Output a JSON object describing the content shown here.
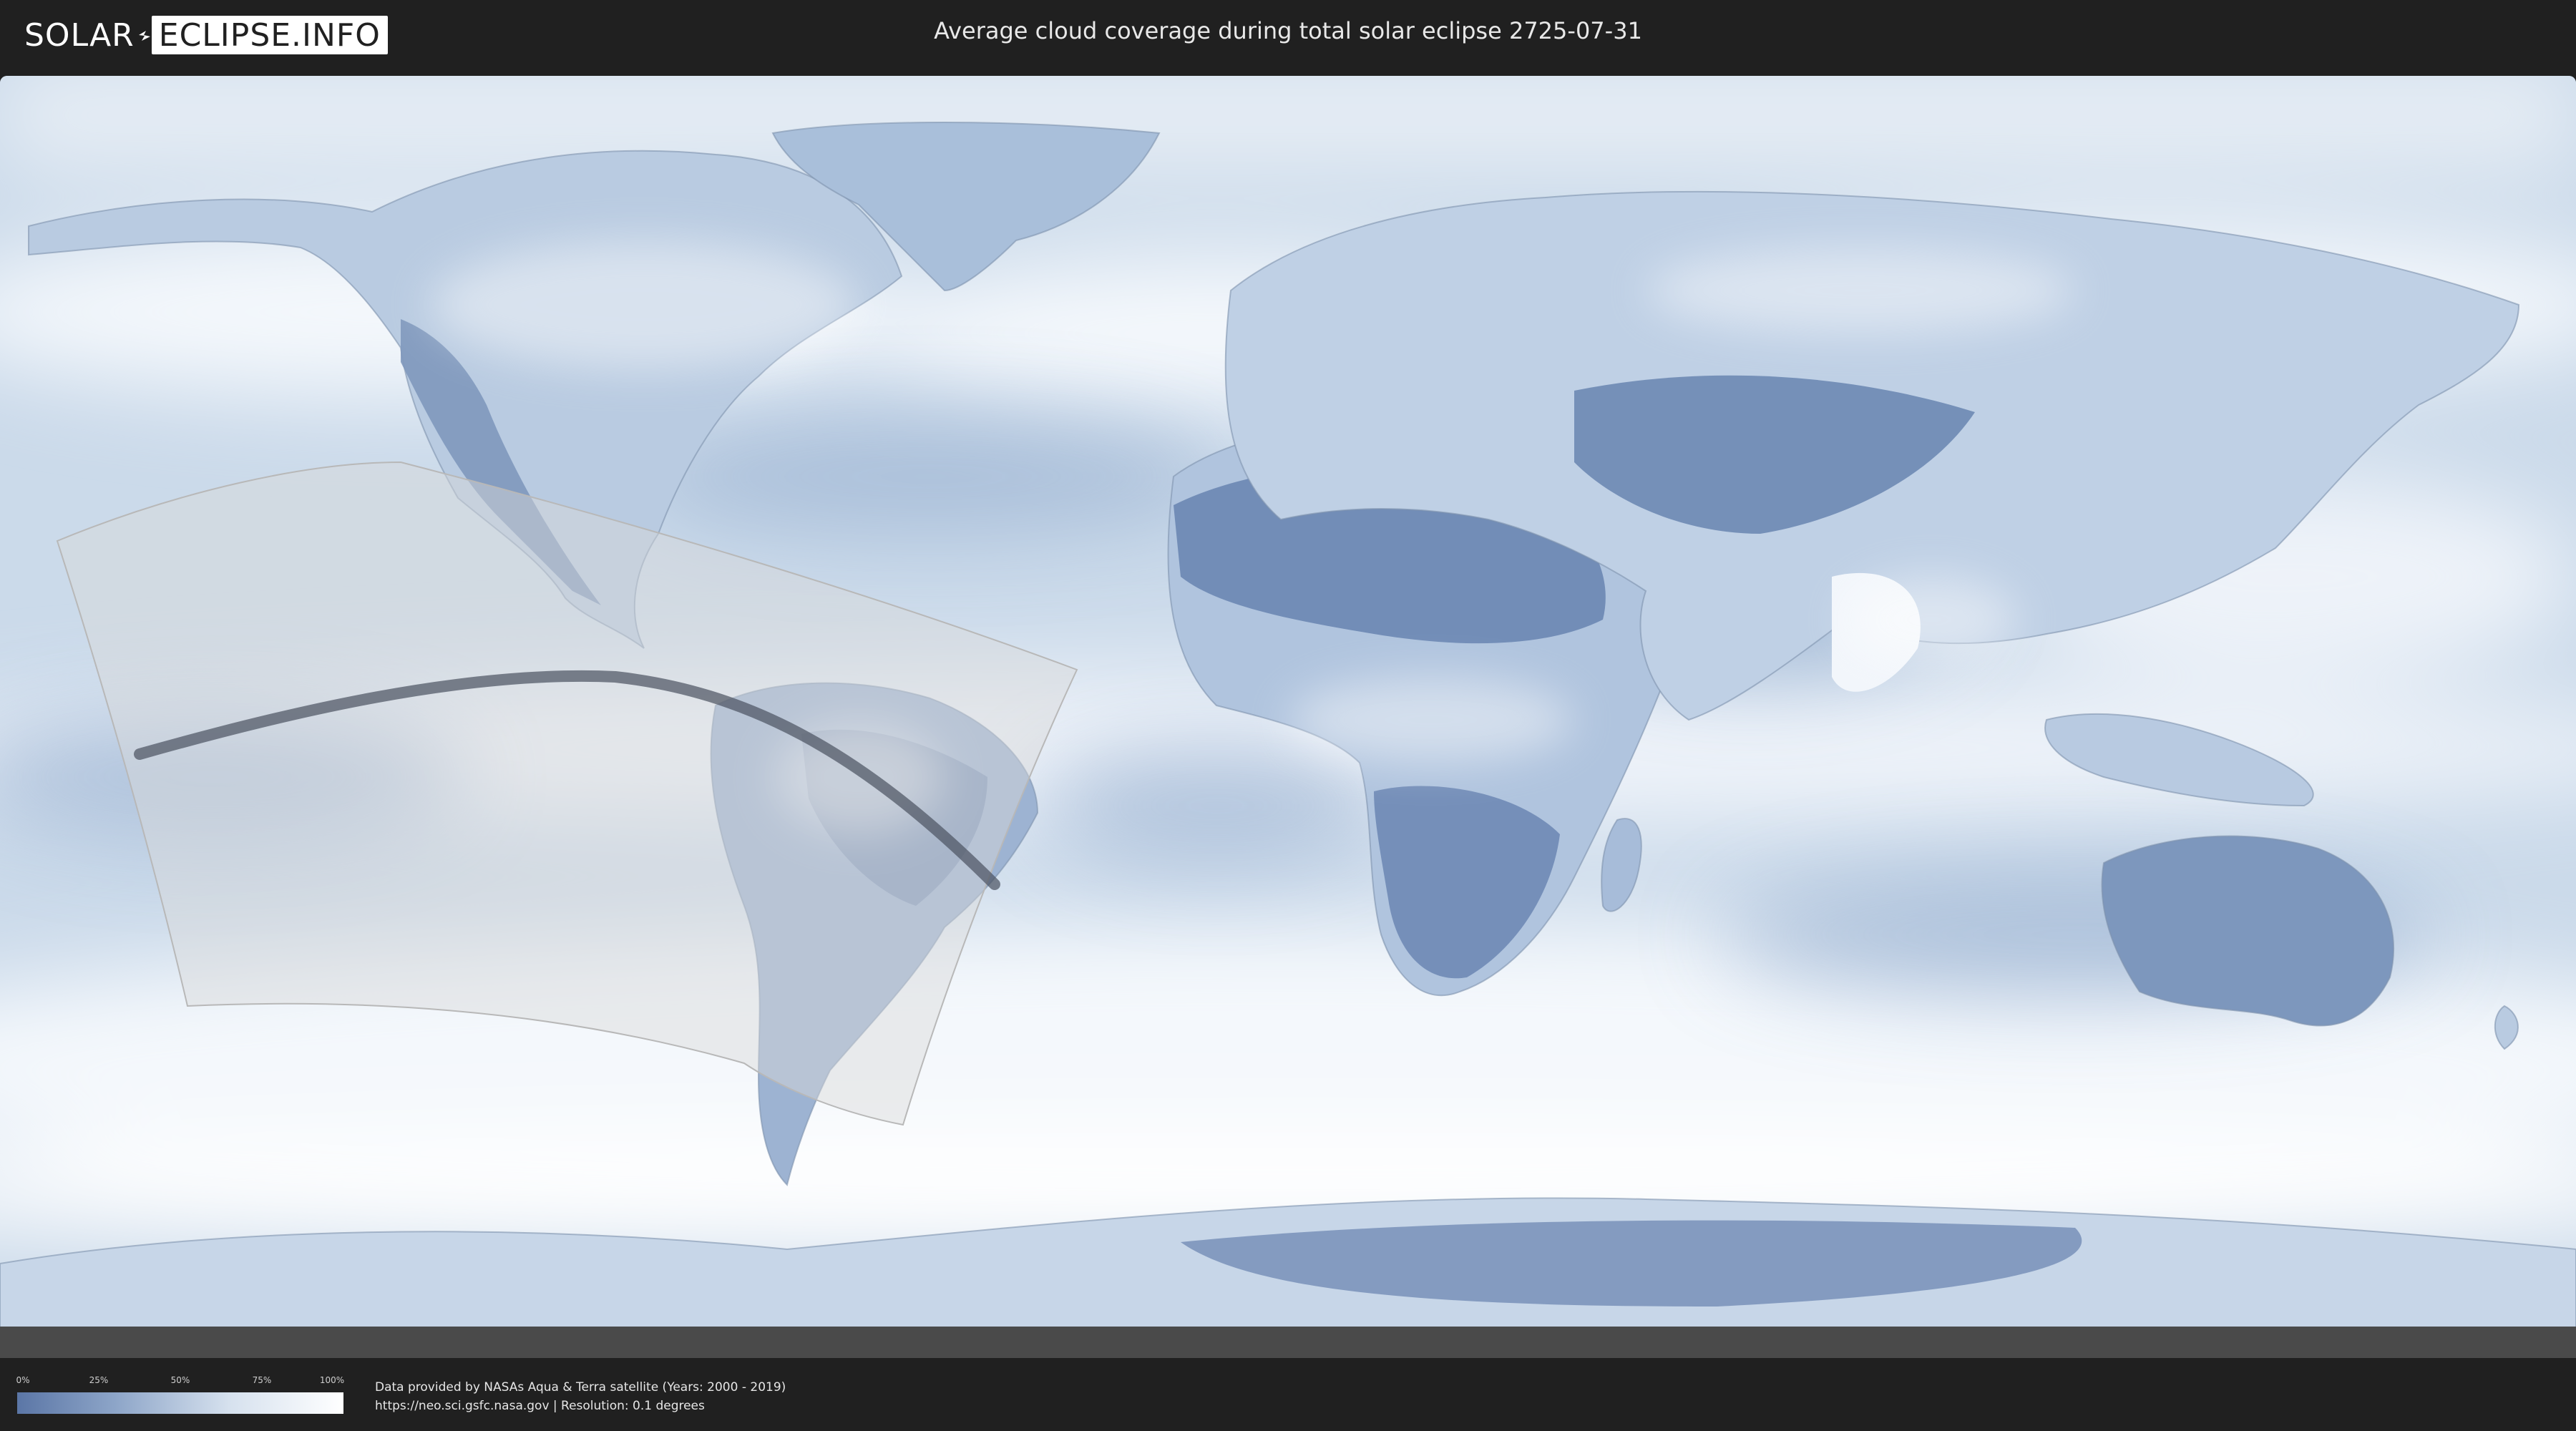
{
  "header": {
    "logo_part1": "SOLAR",
    "logo_part2": "ECLIPSE.INFO",
    "title": "Average cloud coverage during total solar eclipse 2725-07-31"
  },
  "map": {
    "projection": "equirectangular world map",
    "palette": {
      "ocean_cloud": "#c9d8e9",
      "clear_sky": "#5b76a6",
      "full_cloud": "#ffffff",
      "eclipse_zone": "#dcdcdc",
      "totality_path": "#4a5160"
    }
  },
  "legend": {
    "ticks": [
      "0%",
      "25%",
      "50%",
      "75%",
      "100%"
    ]
  },
  "footer": {
    "credit_line1": "Data provided by NASAs Aqua & Terra satellite (Years: 2000 - 2019)",
    "credit_line2": "https://neo.sci.gsfc.nasa.gov | Resolution: 0.1 degrees"
  }
}
